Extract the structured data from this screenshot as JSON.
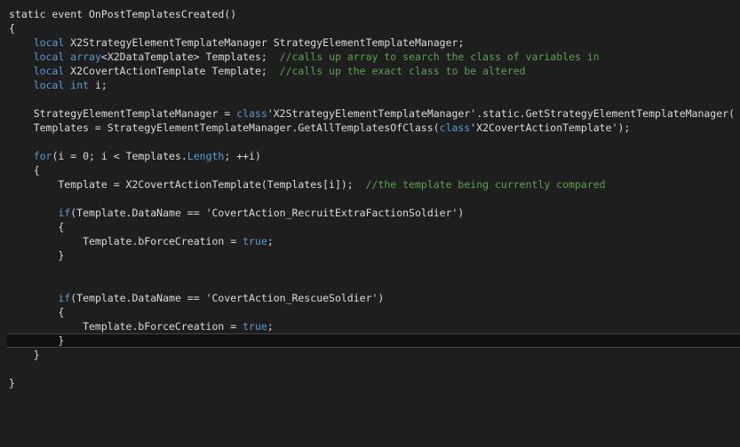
{
  "theme": {
    "background": "#1e1e1e",
    "text": "#dcdcdc",
    "keyword": "#569cd6",
    "comment": "#57a64a",
    "current_line": "#0f0f0f"
  },
  "current_line_index": 23,
  "lines": [
    [
      {
        "t": "static event OnPostTemplatesCreated()",
        "c": "id"
      }
    ],
    [
      {
        "t": "{",
        "c": "id"
      }
    ],
    [
      {
        "t": "    ",
        "c": "id"
      },
      {
        "t": "local",
        "c": "kw"
      },
      {
        "t": " X2StrategyElementTemplateManager StrategyElementTemplateManager;",
        "c": "id"
      }
    ],
    [
      {
        "t": "    ",
        "c": "id"
      },
      {
        "t": "local",
        "c": "kw"
      },
      {
        "t": " ",
        "c": "id"
      },
      {
        "t": "array",
        "c": "kw"
      },
      {
        "t": "<X2DataTemplate> Templates;  ",
        "c": "id"
      },
      {
        "t": "//calls up array to search the class of variables in",
        "c": "cm"
      }
    ],
    [
      {
        "t": "    ",
        "c": "id"
      },
      {
        "t": "local",
        "c": "kw"
      },
      {
        "t": " X2CovertActionTemplate Template;  ",
        "c": "id"
      },
      {
        "t": "//calls up the exact class to be altered",
        "c": "cm"
      }
    ],
    [
      {
        "t": "    ",
        "c": "id"
      },
      {
        "t": "local",
        "c": "kw"
      },
      {
        "t": " ",
        "c": "id"
      },
      {
        "t": "int",
        "c": "kw"
      },
      {
        "t": " i;",
        "c": "id"
      }
    ],
    [
      {
        "t": "",
        "c": "id"
      }
    ],
    [
      {
        "t": "    StrategyElementTemplateManager = ",
        "c": "id"
      },
      {
        "t": "class",
        "c": "kw"
      },
      {
        "t": "'X2StrategyElementTemplateManager'.static.GetStrategyElementTemplateManager(",
        "c": "id"
      }
    ],
    [
      {
        "t": "    Templates = StrategyElementTemplateManager.GetAllTemplatesOfClass(",
        "c": "id"
      },
      {
        "t": "class",
        "c": "kw"
      },
      {
        "t": "'X2CovertActionTemplate');",
        "c": "id"
      }
    ],
    [
      {
        "t": "",
        "c": "id"
      }
    ],
    [
      {
        "t": "    ",
        "c": "id"
      },
      {
        "t": "for",
        "c": "kw"
      },
      {
        "t": "(i = 0; i < Templates.",
        "c": "id"
      },
      {
        "t": "Length",
        "c": "kw"
      },
      {
        "t": "; ++i)",
        "c": "id"
      }
    ],
    [
      {
        "t": "    {",
        "c": "id"
      }
    ],
    [
      {
        "t": "        Template = X2CovertActionTemplate(Templates[i]);  ",
        "c": "id"
      },
      {
        "t": "//the template being currently compared",
        "c": "cm"
      }
    ],
    [
      {
        "t": "",
        "c": "id"
      }
    ],
    [
      {
        "t": "        ",
        "c": "id"
      },
      {
        "t": "if",
        "c": "kw"
      },
      {
        "t": "(Template.DataName == 'CovertAction_RecruitExtraFactionSoldier')",
        "c": "id"
      }
    ],
    [
      {
        "t": "        {",
        "c": "id"
      }
    ],
    [
      {
        "t": "            Template.bForceCreation = ",
        "c": "id"
      },
      {
        "t": "true",
        "c": "kw"
      },
      {
        "t": ";",
        "c": "id"
      }
    ],
    [
      {
        "t": "        }",
        "c": "id"
      }
    ],
    [
      {
        "t": "",
        "c": "id"
      }
    ],
    [
      {
        "t": "",
        "c": "id"
      }
    ],
    [
      {
        "t": "        ",
        "c": "id"
      },
      {
        "t": "if",
        "c": "kw"
      },
      {
        "t": "(Template.DataName == 'CovertAction_RescueSoldier')",
        "c": "id"
      }
    ],
    [
      {
        "t": "        {",
        "c": "id"
      }
    ],
    [
      {
        "t": "            Template.bForceCreation = ",
        "c": "id"
      },
      {
        "t": "true",
        "c": "kw"
      },
      {
        "t": ";",
        "c": "id"
      }
    ],
    [
      {
        "t": "        }",
        "c": "id"
      }
    ],
    [
      {
        "t": "    }",
        "c": "id"
      }
    ],
    [
      {
        "t": "",
        "c": "id"
      }
    ],
    [
      {
        "t": "}",
        "c": "id"
      }
    ]
  ]
}
